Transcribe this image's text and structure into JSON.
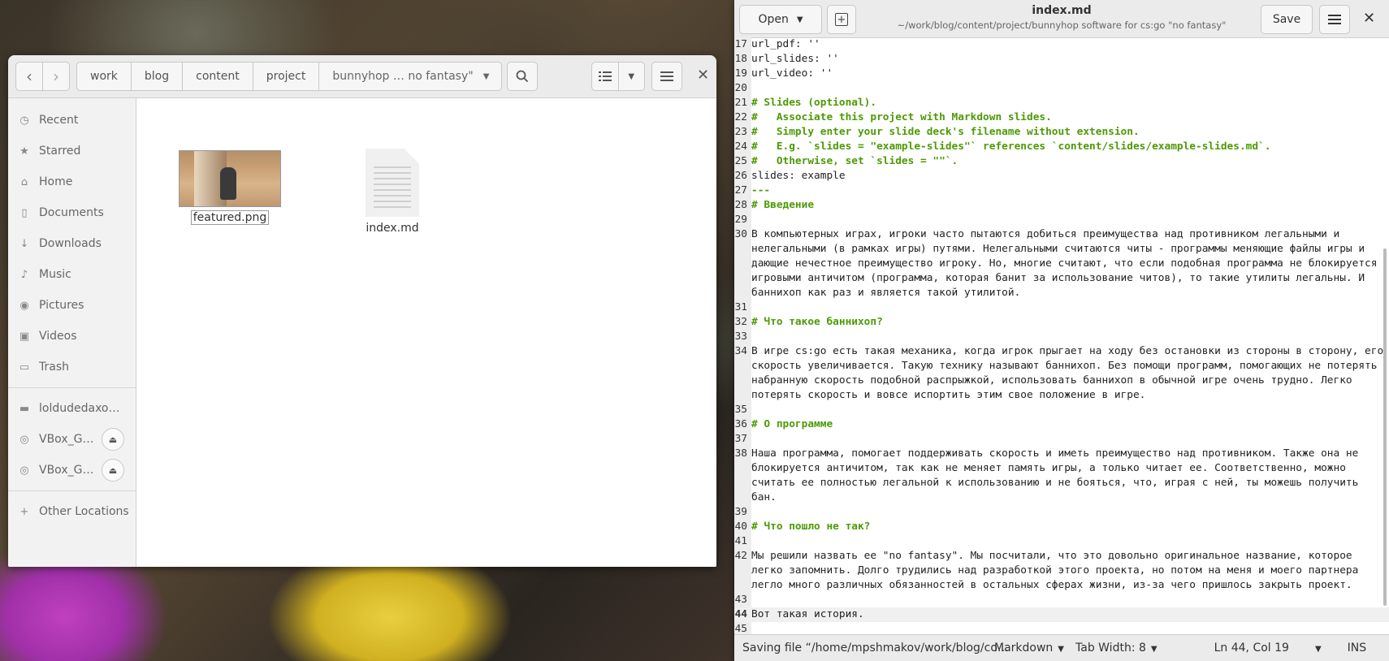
{
  "files": {
    "path": [
      "work",
      "blog",
      "content",
      "project"
    ],
    "current_folder": "bunnyhop … no fantasy\"",
    "sidebar": {
      "items": [
        {
          "name": "recent",
          "icon": "clock-icon",
          "label": "Recent"
        },
        {
          "name": "starred",
          "icon": "star-icon",
          "label": "Starred"
        },
        {
          "name": "home",
          "icon": "home-icon",
          "label": "Home"
        },
        {
          "name": "documents",
          "icon": "document-icon",
          "label": "Documents"
        },
        {
          "name": "downloads",
          "icon": "download-icon",
          "label": "Downloads"
        },
        {
          "name": "music",
          "icon": "music-icon",
          "label": "Music"
        },
        {
          "name": "pictures",
          "icon": "camera-icon",
          "label": "Pictures"
        },
        {
          "name": "videos",
          "icon": "video-icon",
          "label": "Videos"
        },
        {
          "name": "trash",
          "icon": "trash-icon",
          "label": "Trash"
        }
      ],
      "drives": [
        {
          "label": "loldudedaxo…",
          "icon": "drive-icon",
          "ejectable": false
        },
        {
          "label": "VBox_G…",
          "icon": "disc-icon",
          "ejectable": true
        },
        {
          "label": "VBox_G…",
          "icon": "disc-icon",
          "ejectable": true
        }
      ],
      "other_locations": "Other Locations"
    },
    "items": [
      {
        "name": "featured.png",
        "type": "image"
      },
      {
        "name": "index.md",
        "type": "text"
      }
    ]
  },
  "editor": {
    "open_label": "Open",
    "title": "index.md",
    "subtitle": "~/work/blog/content/project/bunnyhop software for cs:go  \"no fantasy\"",
    "save_label": "Save",
    "lines": [
      {
        "n": "17",
        "t": "url_pdf: ''",
        "k": ""
      },
      {
        "n": "18",
        "t": "url_slides: ''",
        "k": ""
      },
      {
        "n": "19",
        "t": "url_video: ''",
        "k": ""
      },
      {
        "n": "20",
        "t": "",
        "k": ""
      },
      {
        "n": "21",
        "t": "# Slides (optional).",
        "k": "c"
      },
      {
        "n": "22",
        "t": "#   Associate this project with Markdown slides.",
        "k": "c"
      },
      {
        "n": "23",
        "t": "#   Simply enter your slide deck's filename without extension.",
        "k": "c"
      },
      {
        "n": "24",
        "t": "#   E.g. `slides = \"example-slides\"` references `content/slides/example-slides.md`.",
        "k": "c"
      },
      {
        "n": "25",
        "t": "#   Otherwise, set `slides = \"\"`.",
        "k": "c"
      },
      {
        "n": "26",
        "t": "slides: example",
        "k": ""
      },
      {
        "n": "27",
        "t": "---",
        "k": "c"
      },
      {
        "n": "28",
        "t": "# Введение",
        "k": "h"
      },
      {
        "n": "29",
        "t": "",
        "k": ""
      },
      {
        "n": "30",
        "t": "В компьютерных играх, игроки часто пытаются добиться преимущества над противником легальными и нелегальными (в рамках игры) путями. Нелегальными считаются читы - программы меняющие файлы игры и дающие нечестное преимущество игроку. Но, многие считают, что если подобная программа не блокируется игровыми античитом (программа, которая банит за использование читов), то такие утилиты легальны. И баннихоп как раз и является такой утилитой.",
        "k": ""
      },
      {
        "n": "31",
        "t": "",
        "k": ""
      },
      {
        "n": "32",
        "t": "# Что такое баннихоп?",
        "k": "h"
      },
      {
        "n": "33",
        "t": "",
        "k": ""
      },
      {
        "n": "34",
        "t": "В игре cs:go есть такая механика, когда игрок прыгает на ходу без остановки из стороны в сторону, его скорость увеличивается. Такую технику называют баннихоп. Без помощи программ, помогающих не потерять набранную скорость подобной распрыжкой, использовать баннихоп в обычной игре очень трудно. Легко потерять скорость и вовсе испортить этим свое положение в игре.",
        "k": ""
      },
      {
        "n": "35",
        "t": "",
        "k": ""
      },
      {
        "n": "36",
        "t": "# О программе",
        "k": "h"
      },
      {
        "n": "37",
        "t": "",
        "k": ""
      },
      {
        "n": "38",
        "t": "Наша программа, помогает поддерживать скорость и иметь преимущество над противником. Также она не блокируется античитом, так как не меняет память игры, а только читает ее. Соответственно, можно считать ее полностью легальной к использованию и не бояться, что, играя с ней, ты можешь получить бан.",
        "k": ""
      },
      {
        "n": "39",
        "t": "",
        "k": ""
      },
      {
        "n": "40",
        "t": "# Что пошло не так?",
        "k": "h"
      },
      {
        "n": "41",
        "t": "",
        "k": ""
      },
      {
        "n": "42",
        "t": "Мы решили назвать ее \"no fantasy\". Мы посчитали, что это довольно оригинальное название, которое легко запомнить. Долго трудились над разработкой этого проекта, но потом на меня и моего партнера легло много различных обязанностей в остальных сферах жизни, из-за чего пришлось закрыть проект.",
        "k": ""
      },
      {
        "n": "43",
        "t": "",
        "k": ""
      },
      {
        "n": "44",
        "t": "Вот такая история.",
        "k": "",
        "current": true
      },
      {
        "n": "45",
        "t": "",
        "k": ""
      }
    ],
    "status": {
      "message": "Saving file “/home/mpshmakov/work/blog/co…",
      "language": "Markdown",
      "tab_width": "Tab Width: 8",
      "position": "Ln 44, Col 19",
      "mode": "INS"
    }
  }
}
